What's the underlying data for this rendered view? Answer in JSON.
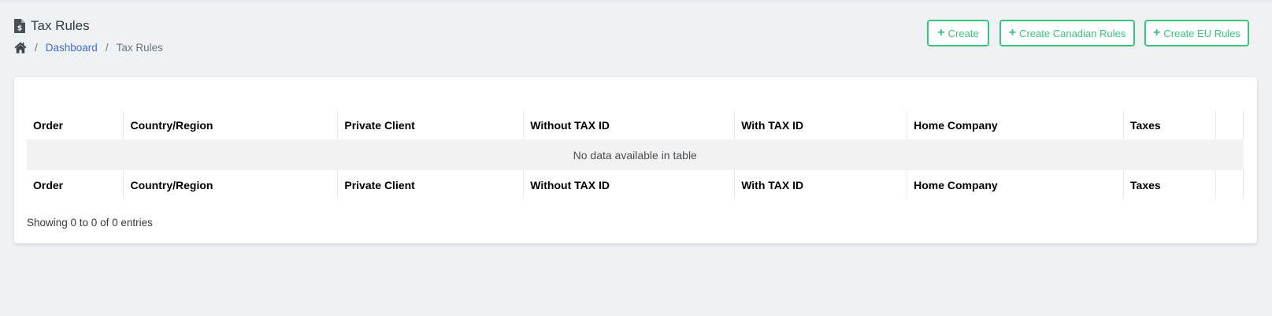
{
  "header": {
    "title": "Tax Rules",
    "title_icon": "file-invoice-dollar-icon",
    "breadcrumb": {
      "home_icon": "home-icon",
      "separator": "/",
      "dashboard": "Dashboard",
      "current": "Tax Rules"
    }
  },
  "actions": {
    "create": "Create",
    "create_canadian": "Create Canadian Rules",
    "create_eu": "Create EU Rules",
    "plus_glyph": "+"
  },
  "table": {
    "columns": [
      "Order",
      "Country/Region",
      "Private Client",
      "Without TAX ID",
      "With TAX ID",
      "Home Company",
      "Taxes",
      ""
    ],
    "empty_message": "No data available in table",
    "info": "Showing 0 to 0 of 0 entries"
  },
  "colors": {
    "accent_green": "#3ac47d",
    "link_blue": "#3f6ad8",
    "background": "#eff2f5"
  }
}
